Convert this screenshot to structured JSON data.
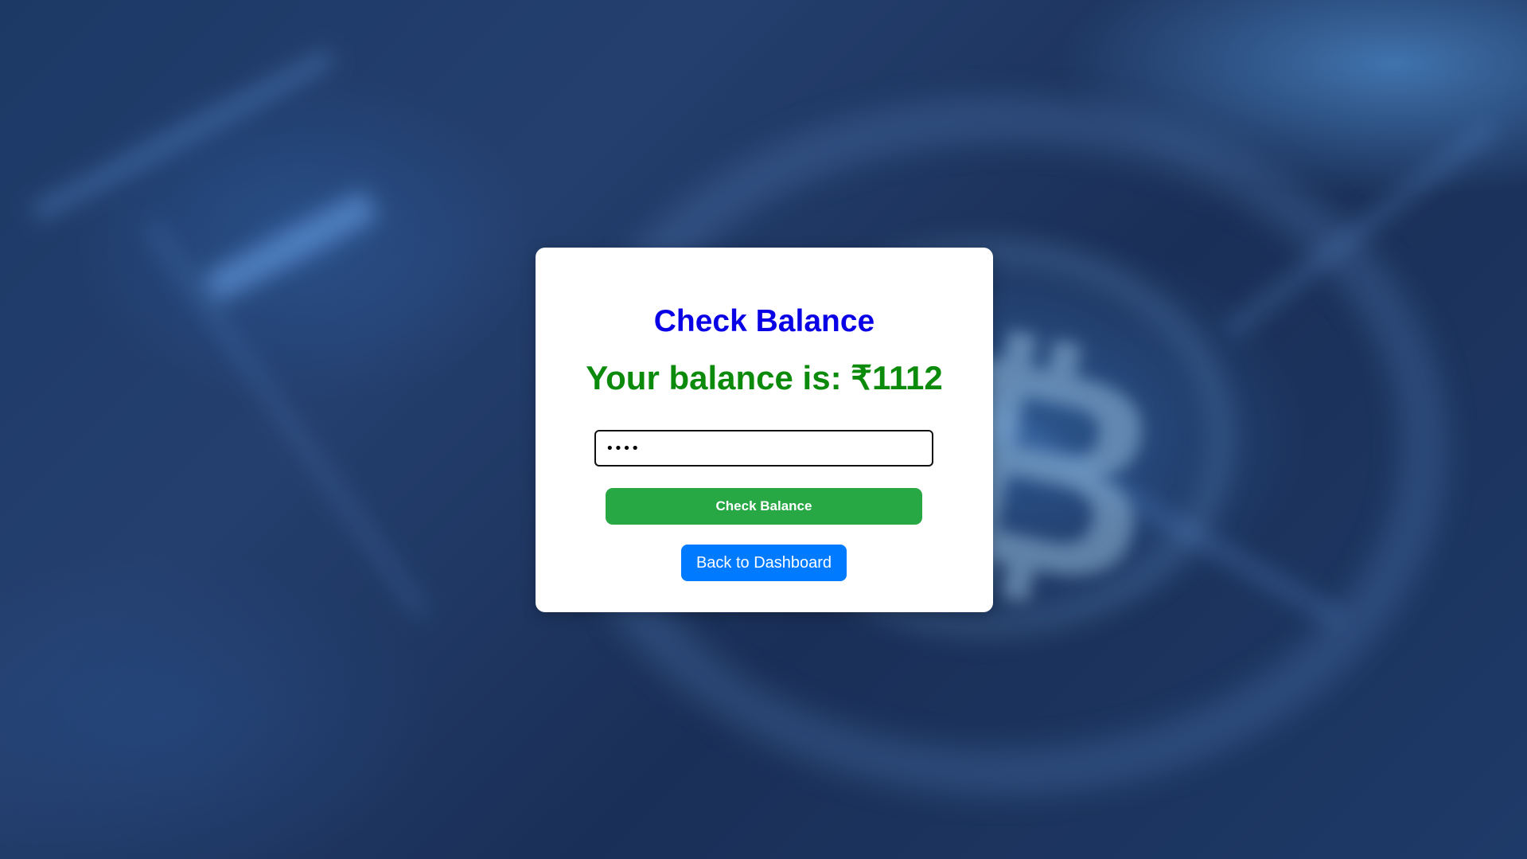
{
  "card": {
    "title": "Check Balance",
    "balance_message": "Your balance is: ₹1112"
  },
  "pin_field": {
    "value": "••••",
    "type": "password"
  },
  "buttons": {
    "check_balance": "Check Balance",
    "back_to_dashboard": "Back to Dashboard"
  },
  "colors": {
    "title": "#0a00e6",
    "balance": "#0c8a0c",
    "check_button": "#28a745",
    "back_button": "#007bff"
  },
  "background": {
    "glyph": "₿"
  }
}
